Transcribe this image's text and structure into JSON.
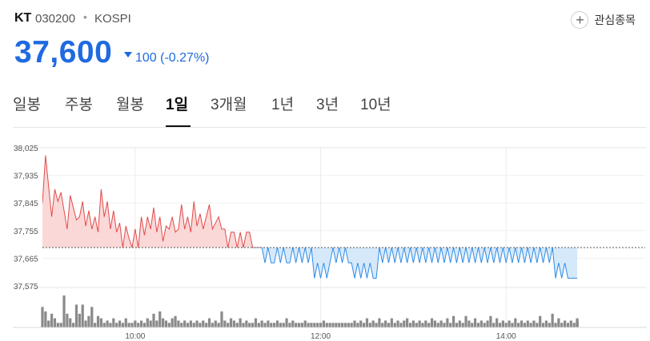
{
  "header": {
    "name": "KT",
    "code": "030200",
    "separator": "•",
    "exchange": "KOSPI",
    "watchlist_label": "관심종목",
    "watchlist_icon": "plus-icon"
  },
  "quote": {
    "price": "37,600",
    "change": "100 (-0.27%)",
    "direction_icon": "down-triangle-icon",
    "color": "#1f6ae0"
  },
  "tabs": [
    {
      "label": "일봉",
      "active": false
    },
    {
      "label": "주봉",
      "active": false
    },
    {
      "label": "월봉",
      "active": false
    },
    {
      "label": "1일",
      "active": true
    },
    {
      "label": "3개월",
      "active": false
    },
    {
      "label": "1년",
      "active": false
    },
    {
      "label": "3년",
      "active": false
    },
    {
      "label": "10년",
      "active": false
    }
  ],
  "colors": {
    "up": "#e24a4a",
    "up_fill": "#fbd8d8",
    "down": "#2e8be6",
    "down_fill": "#d6e9fb",
    "volume": "#8a8a8a"
  },
  "chart_data": {
    "type": "line",
    "reference_price": 37700,
    "ylim": [
      37575,
      38025
    ],
    "yticks": [
      "38,025",
      "37,935",
      "37,845",
      "37,755",
      "37,665",
      "37,575"
    ],
    "yvalues": [
      38025,
      37935,
      37845,
      37755,
      37665,
      37575
    ],
    "xlim": [
      "09:00",
      "15:30"
    ],
    "xticks": [
      "10:00",
      "12:00",
      "14:00"
    ],
    "xvalues": [
      "10:00",
      "12:00",
      "14:00"
    ],
    "grid": true,
    "series": [
      {
        "x": [
          "09:00",
          "09:02",
          "09:04",
          "09:06",
          "09:08",
          "09:10",
          "09:12",
          "09:14",
          "09:16",
          "09:18",
          "09:20",
          "09:22",
          "09:24",
          "09:26",
          "09:28",
          "09:30",
          "09:32",
          "09:34",
          "09:36",
          "09:38",
          "09:40",
          "09:42",
          "09:44",
          "09:46",
          "09:48",
          "09:50",
          "09:52",
          "09:54",
          "09:56",
          "09:58",
          "10:00",
          "10:02",
          "10:04",
          "10:06",
          "10:08",
          "10:10",
          "10:12",
          "10:14",
          "10:16",
          "10:18",
          "10:20",
          "10:22",
          "10:24",
          "10:26",
          "10:28",
          "10:30",
          "10:32",
          "10:34",
          "10:36",
          "10:38",
          "10:40",
          "10:42",
          "10:44",
          "10:46",
          "10:48",
          "10:50",
          "10:52",
          "10:54",
          "10:56",
          "10:58",
          "11:00",
          "11:02",
          "11:04",
          "11:06",
          "11:08",
          "11:10",
          "11:12",
          "11:14",
          "11:16",
          "11:18",
          "11:20",
          "11:22",
          "11:24",
          "11:26",
          "11:28",
          "11:30",
          "11:32",
          "11:34",
          "11:36",
          "11:38",
          "11:40",
          "11:42",
          "11:44",
          "11:46",
          "11:48",
          "11:50",
          "11:52",
          "11:54",
          "11:56",
          "11:58",
          "12:00",
          "12:02",
          "12:04",
          "12:06",
          "12:08",
          "12:10",
          "12:12",
          "12:14",
          "12:16",
          "12:18",
          "12:20",
          "12:22",
          "12:24",
          "12:26",
          "12:28",
          "12:30",
          "12:32",
          "12:34",
          "12:36",
          "12:38",
          "12:40",
          "12:42",
          "12:44",
          "12:46",
          "12:48",
          "12:50",
          "12:52",
          "12:54",
          "12:56",
          "12:58",
          "13:00",
          "13:02",
          "13:04",
          "13:06",
          "13:08",
          "13:10",
          "13:12",
          "13:14",
          "13:16",
          "13:18",
          "13:20",
          "13:22",
          "13:24",
          "13:26",
          "13:28",
          "13:30",
          "13:32",
          "13:34",
          "13:36",
          "13:38",
          "13:40",
          "13:42",
          "13:44",
          "13:46",
          "13:48",
          "13:50",
          "13:52",
          "13:54",
          "13:56",
          "13:58",
          "14:00",
          "14:02",
          "14:04",
          "14:06",
          "14:08",
          "14:10",
          "14:12",
          "14:14",
          "14:16",
          "14:18",
          "14:20",
          "14:22",
          "14:24",
          "14:26",
          "14:28",
          "14:30",
          "14:32",
          "14:34",
          "14:36",
          "14:38",
          "14:40",
          "14:42",
          "14:44",
          "14:46"
        ],
        "values": [
          37845,
          38000,
          37900,
          37800,
          37890,
          37850,
          37880,
          37820,
          37760,
          37870,
          37830,
          37790,
          37800,
          37850,
          37770,
          37820,
          37760,
          37800,
          37750,
          37890,
          37800,
          37850,
          37760,
          37820,
          37750,
          37780,
          37700,
          37770,
          37730,
          37700,
          37760,
          37700,
          37800,
          37740,
          37800,
          37760,
          37830,
          37750,
          37800,
          37720,
          37770,
          37760,
          37800,
          37750,
          37760,
          37840,
          37760,
          37800,
          37750,
          37850,
          37770,
          37810,
          37760,
          37800,
          37840,
          37760,
          37780,
          37800,
          37760,
          37760,
          37700,
          37750,
          37750,
          37700,
          37750,
          37700,
          37750,
          37750,
          37700,
          37700,
          37700,
          37700,
          37650,
          37700,
          37650,
          37650,
          37700,
          37650,
          37700,
          37650,
          37650,
          37700,
          37650,
          37700,
          37650,
          37700,
          37650,
          37700,
          37600,
          37650,
          37600,
          37650,
          37600,
          37650,
          37700,
          37650,
          37700,
          37650,
          37700,
          37650,
          37650,
          37600,
          37650,
          37600,
          37650,
          37600,
          37650,
          37600,
          37600,
          37700,
          37650,
          37700,
          37650,
          37700,
          37650,
          37700,
          37650,
          37700,
          37650,
          37700,
          37650,
          37700,
          37650,
          37700,
          37650,
          37700,
          37650,
          37700,
          37650,
          37700,
          37650,
          37700,
          37650,
          37700,
          37650,
          37700,
          37650,
          37700,
          37650,
          37700,
          37650,
          37700,
          37650,
          37700,
          37650,
          37700,
          37650,
          37700,
          37650,
          37700,
          37650,
          37700,
          37650,
          37700,
          37650,
          37700,
          37650,
          37700,
          37650,
          37700,
          37650,
          37700,
          37650,
          37700,
          37650,
          37700,
          37600,
          37650,
          37600,
          37650,
          37600,
          37600,
          37600,
          37600
        ]
      }
    ],
    "volume": [
      9,
      7,
      3,
      6,
      4,
      2,
      2,
      14,
      6,
      4,
      2,
      10,
      6,
      10,
      3,
      5,
      9,
      2,
      5,
      4,
      2,
      3,
      2,
      4,
      2,
      3,
      2,
      4,
      2,
      2,
      3,
      2,
      3,
      2,
      4,
      3,
      6,
      3,
      7,
      4,
      3,
      2,
      4,
      5,
      3,
      2,
      3,
      2,
      3,
      2,
      3,
      2,
      3,
      2,
      4,
      2,
      3,
      2,
      7,
      3,
      2,
      4,
      3,
      2,
      4,
      2,
      3,
      2,
      2,
      4,
      2,
      3,
      2,
      3,
      2,
      2,
      3,
      2,
      2,
      4,
      2,
      3,
      2,
      2,
      2,
      3,
      2,
      2,
      2,
      2,
      2,
      3,
      2,
      2,
      2,
      2,
      2,
      2,
      2,
      2,
      2,
      3,
      2,
      3,
      2,
      4,
      2,
      3,
      2,
      4,
      2,
      3,
      2,
      4,
      2,
      3,
      2,
      3,
      4,
      2,
      3,
      2,
      3,
      2,
      3,
      2,
      4,
      3,
      2,
      3,
      2,
      4,
      2,
      5,
      2,
      3,
      2,
      5,
      3,
      2,
      4,
      2,
      3,
      2,
      3,
      5,
      2,
      4,
      2,
      3,
      2,
      3,
      2,
      4,
      2,
      3,
      2,
      3,
      2,
      3,
      2,
      5,
      2,
      3,
      2,
      6,
      2,
      4,
      2,
      3,
      2,
      3,
      2,
      3,
      2,
      3,
      2,
      4,
      2,
      3
    ]
  }
}
